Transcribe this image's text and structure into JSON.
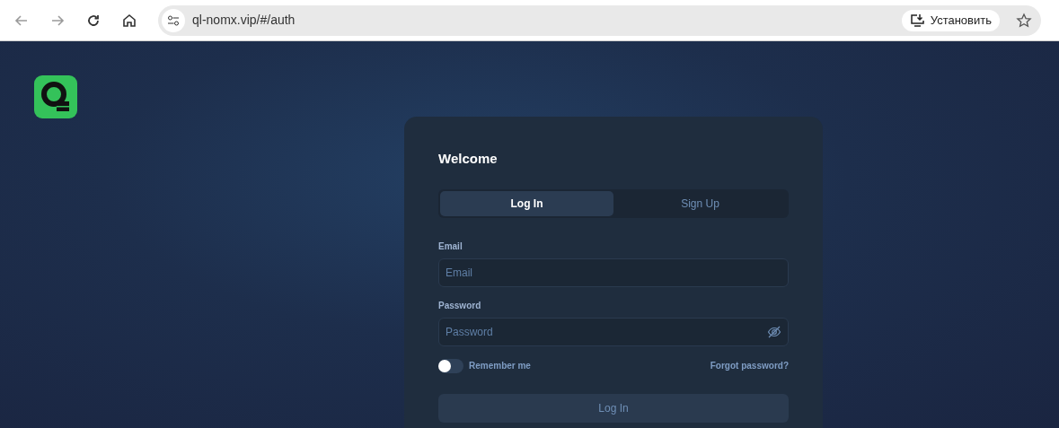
{
  "browser": {
    "url": "ql-nomx.vip/#/auth",
    "install_button": "Установить"
  },
  "card": {
    "title": "Welcome",
    "tabs": [
      {
        "label": "Log In",
        "selected": true
      },
      {
        "label": "Sign Up",
        "selected": false
      }
    ],
    "email": {
      "label": "Email",
      "placeholder": "Email"
    },
    "password": {
      "label": "Password",
      "placeholder": "Password"
    },
    "remember": {
      "label": "Remember me",
      "on": false
    },
    "forgot_link": "Forgot password?",
    "submit": "Log In"
  }
}
